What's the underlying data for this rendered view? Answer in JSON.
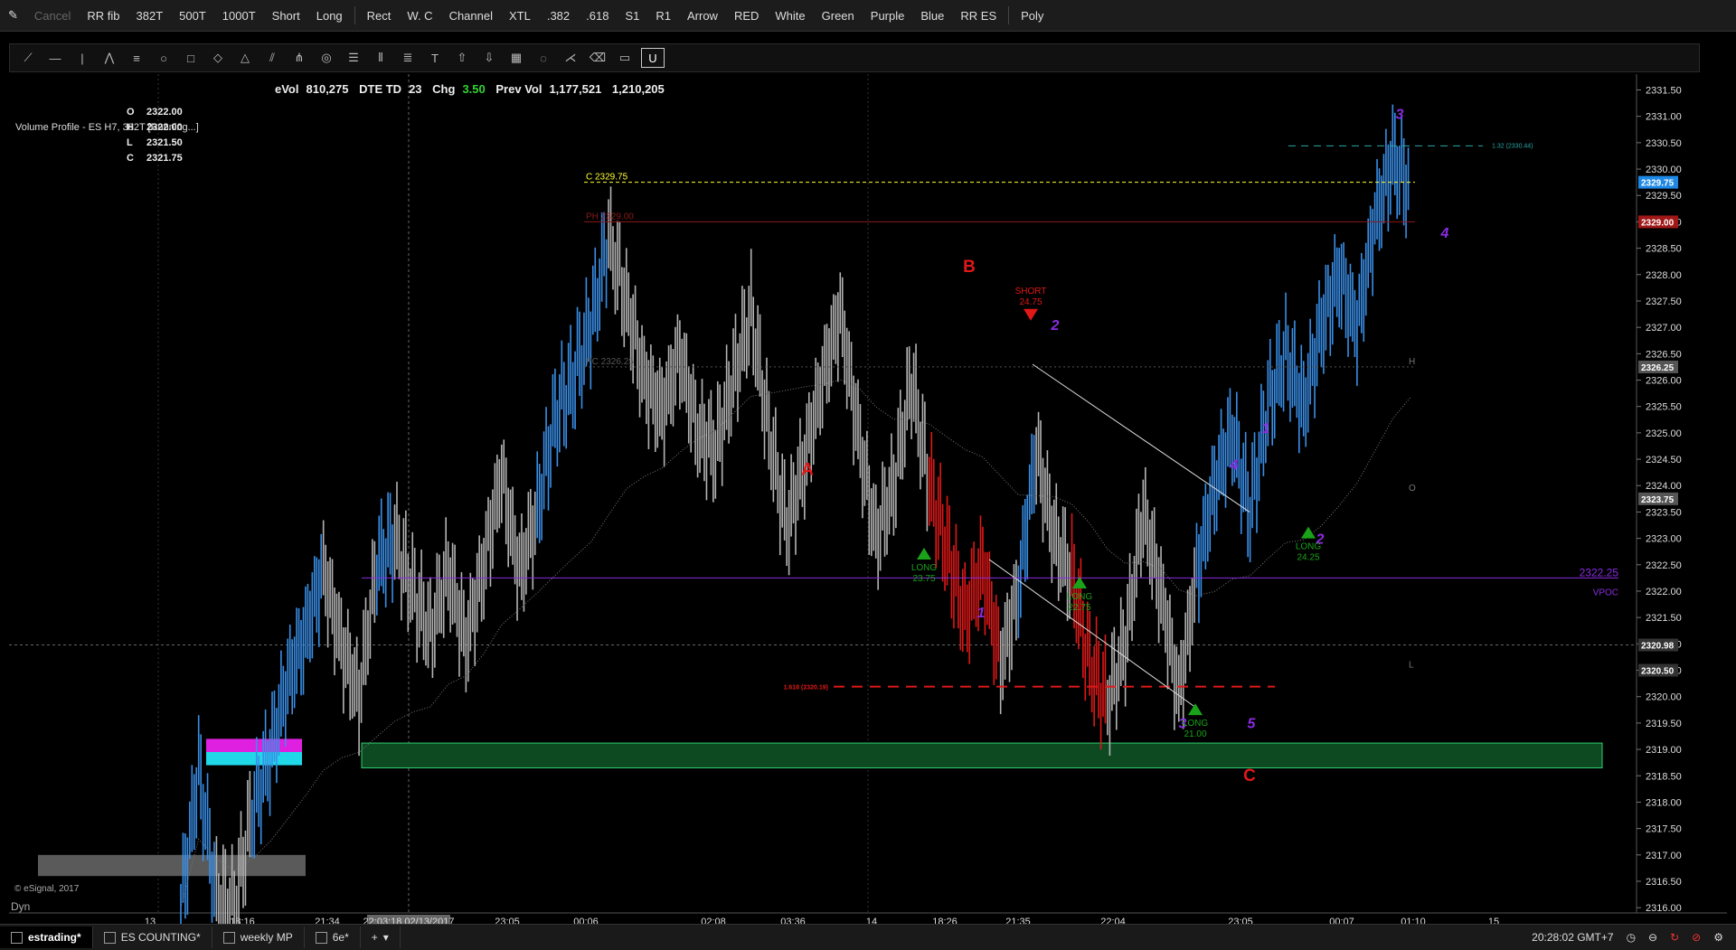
{
  "toolbar_top": {
    "items": [
      "Cancel",
      "RR fib",
      "382T",
      "500T",
      "1000T",
      "Short",
      "Long",
      "Rect",
      "W. C",
      "Channel",
      "XTL",
      ".382",
      ".618",
      "S1",
      "R1",
      "Arrow",
      "RED",
      "White",
      "Green",
      "Purple",
      "Blue",
      "RR ES",
      "Poly"
    ]
  },
  "stats": {
    "evol_label": "eVol",
    "evol": "810,275",
    "dte_label": "DTE TD",
    "dte": "23",
    "chg_label": "Chg",
    "chg": "3.50",
    "prevvol_label": "Prev Vol",
    "prevvol": "1,177,521",
    "vol2": "1,210,205"
  },
  "ohlc": {
    "o_label": "O",
    "o": "2322.00",
    "h_label": "H",
    "h": "2322.00",
    "l_label": "L",
    "l": "2321.50",
    "c_label": "C",
    "c": "2321.75"
  },
  "study_title": "Volume Profile - ES H7, 382T [Running...]",
  "copyright": "© eSignal, 2017",
  "dyn_label": "Dyn",
  "tabs": [
    "estrading*",
    "ES COUNTING*",
    "weekly MP",
    "6e*"
  ],
  "status_time": "20:28:02 GMT+7",
  "colors": {
    "up": "#3a8fe8",
    "neutral": "#b4b4b4",
    "down": "#e01818",
    "purple": "#8a2be2",
    "label_red": "#e01818",
    "long_green": "#1aa31a",
    "band_green": "#0d4a22"
  },
  "chart_data": {
    "type": "bar",
    "ylim": [
      2315.9,
      2331.8
    ],
    "y_ticks": [
      "2331.50",
      "2331.00",
      "2330.50",
      "2330.00",
      "2329.50",
      "2329.00",
      "2328.50",
      "2328.00",
      "2327.50",
      "2327.00",
      "2326.50",
      "2326.00",
      "2325.50",
      "2325.00",
      "2324.50",
      "2324.00",
      "2323.50",
      "2323.00",
      "2322.50",
      "2322.00",
      "2321.50",
      "2321.00",
      "2320.50",
      "2320.00",
      "2319.50",
      "2319.00",
      "2318.50",
      "2318.00",
      "2317.50",
      "2317.00",
      "2316.50",
      "2316.00"
    ],
    "x_ticks": [
      "13",
      "18:16",
      "21:34",
      "22:03:18 02/13/2017",
      "23:05",
      "00:06",
      "02:08",
      "03:36",
      "14",
      "18:26",
      "21:35",
      "22:04",
      "23:05",
      "00:07",
      "01:10",
      "15"
    ],
    "price_path": [
      {
        "v": 2316.0,
        "c": "up"
      },
      {
        "v": 2318.6,
        "c": "up"
      },
      {
        "v": 2316.2,
        "c": "up"
      },
      {
        "v": 2316.0,
        "c": "neutral"
      },
      {
        "v": 2317.8,
        "c": "neutral"
      },
      {
        "v": 2318.9,
        "c": "up"
      },
      {
        "v": 2320.3,
        "c": "up"
      },
      {
        "v": 2321.2,
        "c": "up"
      },
      {
        "v": 2322.4,
        "c": "up"
      },
      {
        "v": 2321.0,
        "c": "neutral"
      },
      {
        "v": 2320.0,
        "c": "neutral"
      },
      {
        "v": 2322.5,
        "c": "neutral"
      },
      {
        "v": 2323.0,
        "c": "up"
      },
      {
        "v": 2322.0,
        "c": "neutral"
      },
      {
        "v": 2321.2,
        "c": "neutral"
      },
      {
        "v": 2322.4,
        "c": "neutral"
      },
      {
        "v": 2321.0,
        "c": "neutral"
      },
      {
        "v": 2322.5,
        "c": "neutral"
      },
      {
        "v": 2324.2,
        "c": "neutral"
      },
      {
        "v": 2322.3,
        "c": "neutral"
      },
      {
        "v": 2323.5,
        "c": "neutral"
      },
      {
        "v": 2325.3,
        "c": "up"
      },
      {
        "v": 2326.0,
        "c": "up"
      },
      {
        "v": 2327.0,
        "c": "up"
      },
      {
        "v": 2328.7,
        "c": "up"
      },
      {
        "v": 2327.5,
        "c": "neutral"
      },
      {
        "v": 2326.0,
        "c": "neutral"
      },
      {
        "v": 2325.4,
        "c": "neutral"
      },
      {
        "v": 2326.5,
        "c": "neutral"
      },
      {
        "v": 2325.0,
        "c": "neutral"
      },
      {
        "v": 2324.7,
        "c": "neutral"
      },
      {
        "v": 2326.0,
        "c": "neutral"
      },
      {
        "v": 2327.3,
        "c": "neutral"
      },
      {
        "v": 2325.0,
        "c": "neutral"
      },
      {
        "v": 2323.2,
        "c": "neutral"
      },
      {
        "v": 2324.5,
        "c": "neutral"
      },
      {
        "v": 2326.0,
        "c": "neutral"
      },
      {
        "v": 2327.3,
        "c": "neutral"
      },
      {
        "v": 2325.0,
        "c": "neutral"
      },
      {
        "v": 2323.0,
        "c": "neutral"
      },
      {
        "v": 2324.0,
        "c": "neutral"
      },
      {
        "v": 2326.0,
        "c": "neutral"
      },
      {
        "v": 2324.0,
        "c": "neutral"
      },
      {
        "v": 2322.8,
        "c": "down"
      },
      {
        "v": 2321.5,
        "c": "down"
      },
      {
        "v": 2322.5,
        "c": "down"
      },
      {
        "v": 2320.6,
        "c": "down"
      },
      {
        "v": 2322.0,
        "c": "neutral"
      },
      {
        "v": 2324.7,
        "c": "up"
      },
      {
        "v": 2323.0,
        "c": "neutral"
      },
      {
        "v": 2322.3,
        "c": "neutral"
      },
      {
        "v": 2320.6,
        "c": "down"
      },
      {
        "v": 2319.9,
        "c": "down"
      },
      {
        "v": 2321.0,
        "c": "neutral"
      },
      {
        "v": 2323.5,
        "c": "neutral"
      },
      {
        "v": 2322.0,
        "c": "neutral"
      },
      {
        "v": 2320.0,
        "c": "neutral"
      },
      {
        "v": 2322.3,
        "c": "neutral"
      },
      {
        "v": 2324.0,
        "c": "up"
      },
      {
        "v": 2325.0,
        "c": "up"
      },
      {
        "v": 2323.5,
        "c": "up"
      },
      {
        "v": 2325.5,
        "c": "up"
      },
      {
        "v": 2326.5,
        "c": "up"
      },
      {
        "v": 2325.5,
        "c": "up"
      },
      {
        "v": 2327.0,
        "c": "up"
      },
      {
        "v": 2328.0,
        "c": "up"
      },
      {
        "v": 2327.0,
        "c": "up"
      },
      {
        "v": 2329.0,
        "c": "up"
      },
      {
        "v": 2330.2,
        "c": "up"
      },
      {
        "v": 2329.6,
        "c": "up"
      }
    ],
    "levels": [
      {
        "label": "C 2329.75",
        "value": 2329.75,
        "color": "#ffff33",
        "dash": "4,3"
      },
      {
        "label": "PH 2329.00",
        "value": 2329.0,
        "color": "#8b1a1a",
        "dash": ""
      },
      {
        "label": "PC 2326.25",
        "value": 2326.25,
        "color": "#555555",
        "dash": "2,3"
      },
      {
        "label": "2322.25",
        "value": 2322.25,
        "color": "#8a2be2",
        "dash": ""
      },
      {
        "label": "1.618 (2320.19)",
        "value": 2320.19,
        "color": "#e01818",
        "dash": "12,8"
      },
      {
        "label": "1.32 (2330.44)",
        "value": 2330.44,
        "color": "#2aa8a8",
        "dash": "8,6"
      }
    ],
    "price_badges": [
      {
        "label": "2329.75",
        "value": 2329.75,
        "color": "#1e88e5"
      },
      {
        "label": "2329.00",
        "value": 2329.0,
        "color": "#a01818"
      },
      {
        "label": "2326.25",
        "value": 2326.25,
        "color": "#555555"
      },
      {
        "label": "2323.75",
        "value": 2323.75,
        "color": "#555555"
      },
      {
        "label": "2320.98",
        "value": 2320.98,
        "color": "#333333"
      },
      {
        "label": "2320.50",
        "value": 2320.5,
        "color": "#333333"
      }
    ],
    "vpoc_label": "VPOC",
    "hol_labels": [
      "H",
      "O",
      "L"
    ],
    "wave_labels": [
      {
        "t": "A",
        "color": "red",
        "big": true
      },
      {
        "t": "B",
        "color": "red",
        "big": true
      },
      {
        "t": "C",
        "color": "red",
        "big": true
      },
      {
        "t": "1",
        "color": "purple"
      },
      {
        "t": "2",
        "color": "purple"
      },
      {
        "t": "3",
        "color": "purple"
      },
      {
        "t": "4",
        "color": "purple"
      },
      {
        "t": "5",
        "color": "purple"
      },
      {
        "t": "1",
        "color": "purple"
      },
      {
        "t": "2",
        "color": "purple"
      },
      {
        "t": "3",
        "color": "purple"
      },
      {
        "t": "4",
        "color": "purple"
      }
    ],
    "signals": [
      {
        "type": "LONG",
        "value": "23.75"
      },
      {
        "type": "LONG",
        "value": "22.75"
      },
      {
        "type": "LONG",
        "value": "21.00"
      },
      {
        "type": "LONG",
        "value": "24.25"
      },
      {
        "type": "SHORT",
        "value": "24.75"
      }
    ]
  }
}
